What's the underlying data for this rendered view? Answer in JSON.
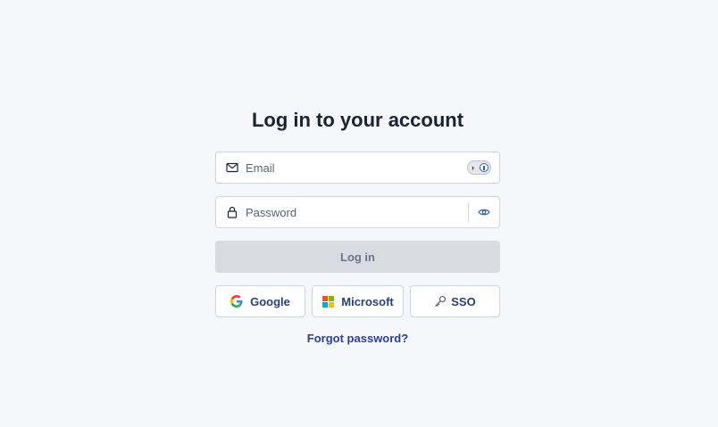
{
  "page": {
    "title": "Log in to your account"
  },
  "form": {
    "email": {
      "value": "",
      "placeholder": "Email"
    },
    "password": {
      "value": "",
      "placeholder": "Password"
    },
    "login_label": "Log in",
    "forgot_label": "Forgot password?"
  },
  "providers": {
    "google_label": "Google",
    "microsoft_label": "Microsoft",
    "sso_label": "SSO"
  },
  "icons": {
    "email": "envelope-icon",
    "password": "lock-icon",
    "password_manager": "password-manager-icon",
    "visibility": "eye-icon",
    "google": "google-logo-icon",
    "microsoft": "microsoft-logo-icon",
    "sso": "key-icon"
  },
  "colors": {
    "background": "#f5f7fa",
    "title": "#1b2230",
    "link": "#2a3f9a",
    "provider_text": "#2a3f7a",
    "login_disabled_bg": "#d8dbe1",
    "login_disabled_text": "#6c7583",
    "border": "#cfd5df"
  }
}
